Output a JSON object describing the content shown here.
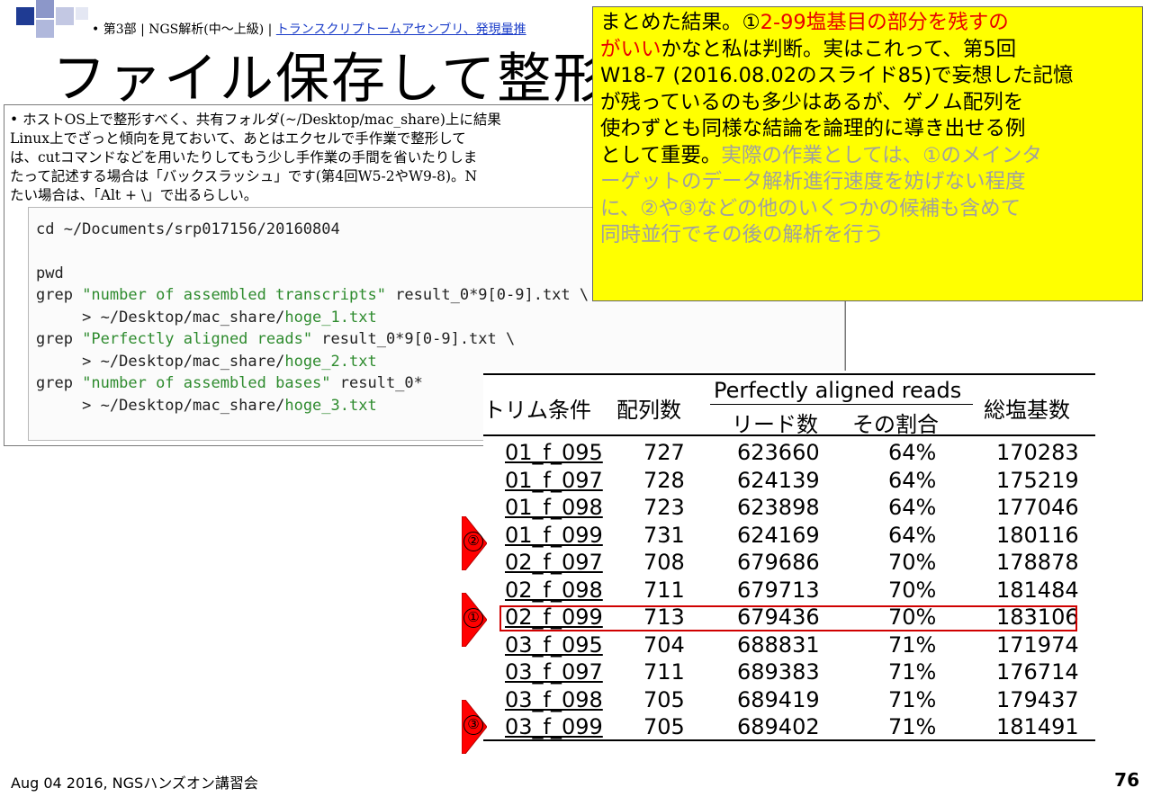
{
  "header": {
    "subtitle_prefix": "• 第3部 | NGS解析(中～上級) | ",
    "subtitle_link": "トランスクリプトームアセンブリ、発現量推",
    "title": "ファイル保存して整形"
  },
  "bullet": {
    "lines": [
      "• ホストOS上で整形すべく、共有フォルダ(~/Desktop/mac_share)上に結果",
      "  Linux上でざっと傾向を見ておいて、あとはエクセルで手作業で整形して",
      "  は、cutコマンドなどを用いたりしてもう少し手作業の手間を省いたりしま",
      "  たって記述する場合は「バックスラッシュ」です(第4回W5-2やW9-8)。N",
      "  たい場合は、「Alt + \\」で出るらしい。"
    ]
  },
  "code": {
    "l1": "cd ~/Documents/srp017156/20160804",
    "l2": "pwd",
    "l3a": "grep ",
    "l3s": "\"number of assembled transcripts\"",
    "l3b": " result_0*9[0-9].txt \\",
    "l4a": "     > ~/Desktop/mac_share/",
    "l4s": "hoge_1.txt",
    "l5a": "grep ",
    "l5s": "\"Perfectly aligned reads\"",
    "l5b": " result_0*9[0-9].txt \\",
    "l6a": "     > ~/Desktop/mac_share/",
    "l6s": "hoge_2.txt",
    "l7a": "grep ",
    "l7s": "\"number of assembled bases\"",
    "l7b": " result_0*",
    "l8a": "     > ~/Desktop/mac_share/",
    "l8s": "hoge_3.txt"
  },
  "note": {
    "p1": "まとめた結果。①",
    "p2_red": "2-99塩基目の部分を残すの",
    "p3_red": "がいい",
    "p4": "かなと私は判断。実はこれって、第5回",
    "p5": "W18-7 (2016.08.02のスライド85)で妄想した記憶",
    "p6": "が残っているのも多少はあるが、ゲノム配列を",
    "p7": "使わずとも同様な結論を論理的に導き出せる例",
    "p8": "として重要。",
    "p9_gray": "実際の作業としては、①のメインタ",
    "p10_gray": "ーゲットのデータ解析進行速度を妨げない程度",
    "p11_gray": "に、②や③などの他のいくつかの候補も含めて",
    "p12_gray": "同時並行でその後の解析を行う"
  },
  "table": {
    "h_trim": "トリム条件",
    "h_count": "配列数",
    "h_pa": "Perfectly aligned reads",
    "h_reads": "リード数",
    "h_ratio": "その割合",
    "h_total": "総塩基数",
    "rows": [
      [
        "01_f_095",
        "727",
        "623660",
        "64%",
        "170283"
      ],
      [
        "01_f_097",
        "728",
        "624139",
        "64%",
        "175219"
      ],
      [
        "01_f_098",
        "723",
        "623898",
        "64%",
        "177046"
      ],
      [
        "01_f_099",
        "731",
        "624169",
        "64%",
        "180116"
      ],
      [
        "02_f_097",
        "708",
        "679686",
        "70%",
        "178878"
      ],
      [
        "02_f_098",
        "711",
        "679713",
        "70%",
        "181484"
      ],
      [
        "02_f_099",
        "713",
        "679436",
        "70%",
        "183106"
      ],
      [
        "03_f_095",
        "704",
        "688831",
        "71%",
        "171974"
      ],
      [
        "03_f_097",
        "711",
        "689383",
        "71%",
        "176714"
      ],
      [
        "03_f_098",
        "705",
        "689419",
        "71%",
        "179437"
      ],
      [
        "03_f_099",
        "705",
        "689402",
        "71%",
        "181491"
      ]
    ]
  },
  "arrows": {
    "a1": "①",
    "a2": "②",
    "a3": "③"
  },
  "footer": {
    "left": "Aug 04 2016, NGSハンズオン講習会",
    "page": "76"
  }
}
